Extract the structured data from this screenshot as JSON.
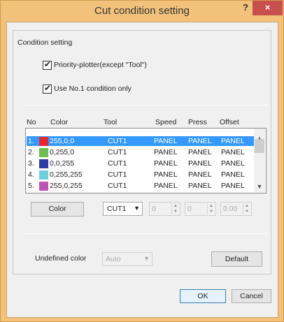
{
  "window": {
    "title": "Cut condition setting",
    "help_label": "?",
    "close_label": "×"
  },
  "condition_group": {
    "label": "Condition setting",
    "priority_plotter": {
      "label": "Priority-plotter(except \"Tool\")",
      "checked": true
    },
    "use_no1": {
      "label": "Use No.1 condition only",
      "checked": true
    }
  },
  "table": {
    "headers": [
      "No",
      "Color",
      "Tool",
      "Speed",
      "Press",
      "Offset"
    ],
    "rows": [
      {
        "no": "1.",
        "color": "255,0,0",
        "swatch": "#e8262b",
        "tool": "CUT1",
        "speed": "PANEL",
        "press": "PANEL",
        "offset": "PANEL",
        "selected": true
      },
      {
        "no": "2.",
        "color": "0,255,0",
        "swatch": "#6ac04a",
        "tool": "CUT1",
        "speed": "PANEL",
        "press": "PANEL",
        "offset": "PANEL",
        "selected": false
      },
      {
        "no": "3.",
        "color": "0,0,255",
        "swatch": "#2b3aa8",
        "tool": "CUT1",
        "speed": "PANEL",
        "press": "PANEL",
        "offset": "PANEL",
        "selected": false
      },
      {
        "no": "4.",
        "color": "0,255,255",
        "swatch": "#6ccfdf",
        "tool": "CUT1",
        "speed": "PANEL",
        "press": "PANEL",
        "offset": "PANEL",
        "selected": false
      },
      {
        "no": "5.",
        "color": "255,0,255",
        "swatch": "#c052b8",
        "tool": "CUT1",
        "speed": "PANEL",
        "press": "PANEL",
        "offset": "PANEL",
        "selected": false
      }
    ]
  },
  "editor": {
    "color_button": "Color",
    "tool_value": "CUT1",
    "speed_value": "0",
    "press_value": "0",
    "offset_value": "0.00"
  },
  "undefined_color": {
    "label": "Undefined color",
    "value": "Auto",
    "default_button": "Default"
  },
  "footer": {
    "ok": "OK",
    "cancel": "Cancel"
  },
  "colors": {
    "title_bar": "#f2c27a",
    "close_button": "#c7504f",
    "selection": "#3399ff"
  }
}
